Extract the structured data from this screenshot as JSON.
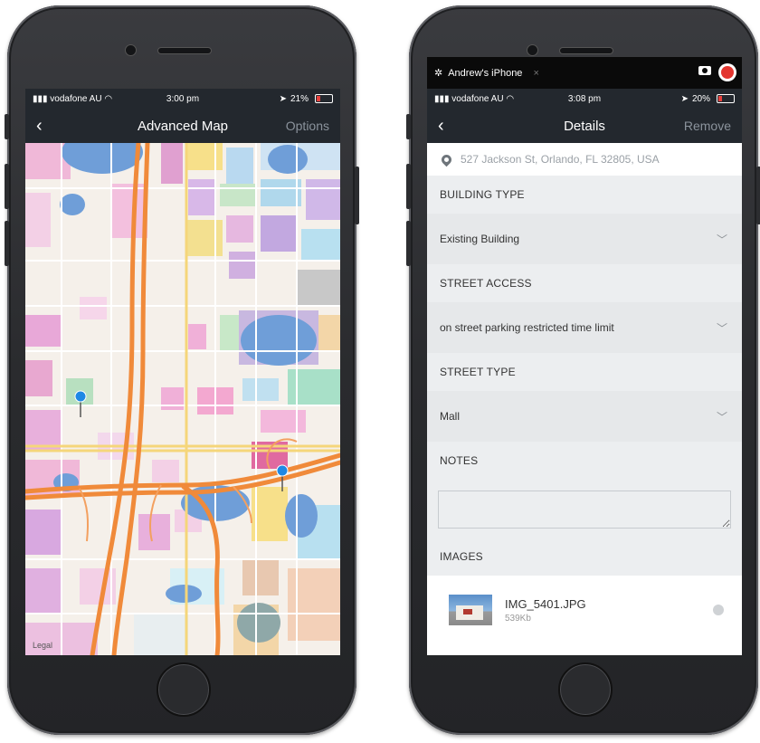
{
  "left_phone": {
    "status": {
      "carrier": "vodafone AU",
      "time": "3:00 pm",
      "battery": "21%"
    },
    "nav": {
      "back": "‹",
      "title": "Advanced Map",
      "action": "Options"
    },
    "map": {
      "legal": "Legal"
    }
  },
  "right_phone": {
    "recording_bar": {
      "device": "Andrew's iPhone",
      "close": "×"
    },
    "status": {
      "carrier": "vodafone AU",
      "time": "3:08 pm",
      "battery": "20%"
    },
    "nav": {
      "back": "‹",
      "title": "Details",
      "action": "Remove"
    },
    "address": "527 Jackson St, Orlando, FL 32805, USA",
    "building_type": {
      "label": "BUILDING TYPE",
      "value": "Existing Building"
    },
    "street_access": {
      "label": "STREET ACCESS",
      "value": "on street parking restricted time limit"
    },
    "street_type": {
      "label": "STREET TYPE",
      "value": "Mall"
    },
    "notes": {
      "label": "NOTES",
      "value": ""
    },
    "images": {
      "label": "IMAGES",
      "items": [
        {
          "name": "IMG_5401.JPG",
          "size": "539Kb"
        }
      ]
    }
  }
}
